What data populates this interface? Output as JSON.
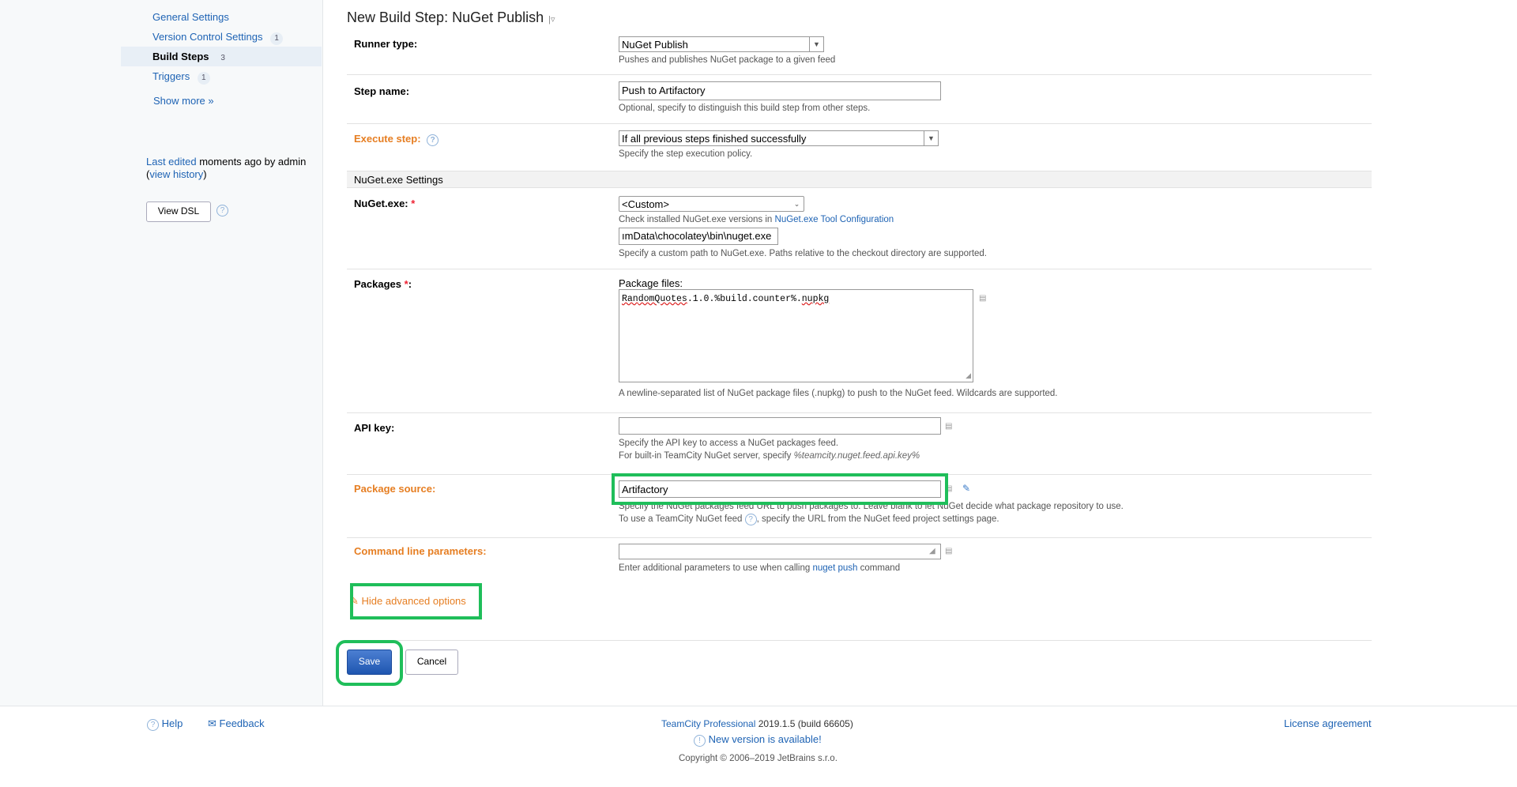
{
  "sidebar": {
    "items": [
      {
        "label": "General Settings",
        "badge": ""
      },
      {
        "label": "Version Control Settings",
        "badge": "1"
      },
      {
        "label": "Build Steps",
        "badge": "3"
      },
      {
        "label": "Triggers",
        "badge": "1"
      }
    ],
    "show_more": "Show more »",
    "last_edited_link": "Last edited",
    "last_edited_text": " moments ago by admin",
    "view_history_prefix": "(",
    "view_history": "view history",
    "view_history_suffix": ")",
    "view_dsl": "View DSL"
  },
  "page": {
    "title": "New Build Step: NuGet Publish",
    "title_caret": "|▿"
  },
  "runner": {
    "label": "Runner type:",
    "value": "NuGet Publish",
    "note": "Pushes and publishes NuGet package to a given feed"
  },
  "step_name": {
    "label": "Step name:",
    "value": "Push to Artifactory",
    "note": "Optional, specify to distinguish this build step from other steps."
  },
  "execute": {
    "label": "Execute step:",
    "value": "If all previous steps finished successfully",
    "note": "Specify the step execution policy."
  },
  "section": {
    "title": "NuGet.exe Settings"
  },
  "nuget_exe": {
    "label": "NuGet.exe:",
    "required": "*",
    "value": "<Custom>",
    "note_prefix": "Check installed NuGet.exe versions in ",
    "note_link": "NuGet.exe Tool Configuration",
    "path": "ımData\\chocolatey\\bin\\nuget.exe",
    "path_note": "Specify a custom path to NuGet.exe. Paths relative to the checkout directory are supported."
  },
  "packages": {
    "label": "Packages",
    "required": "*",
    "label_suffix": ":",
    "files_label": "Package files:",
    "value_a": "Ran",
    "value_b": "domQuotes",
    "value_c": ".1.0.%build.counter%.",
    "value_d": "nupkg",
    "note": "A newline-separated list of NuGet package files (.nupkg) to push to the NuGet feed. Wildcards are supported."
  },
  "api_key": {
    "label": "API key:",
    "value": "",
    "note1": "Specify the API key to access a NuGet packages feed.",
    "note2_prefix": "For built-in TeamCity NuGet server, specify ",
    "note2_param": "%teamcity.nuget.feed.api.key%"
  },
  "source": {
    "label": "Package source:",
    "value": "Artifactory",
    "note1": "Specify the NuGet packages feed URL to push packages to. Leave blank to let NuGet decide what package repository to use.",
    "note2_prefix": "To use a TeamCity NuGet feed ",
    "note2_suffix": ", specify the URL from the NuGet feed project settings page."
  },
  "cmdline": {
    "label": "Command line parameters:",
    "value": "",
    "note_prefix": "Enter additional parameters to use when calling ",
    "note_link": "nuget push",
    "note_suffix": " command"
  },
  "actions": {
    "hide_advanced": "Hide advanced options",
    "save": "Save",
    "cancel": "Cancel"
  },
  "footer": {
    "help": "Help",
    "feedback": "Feedback",
    "product_link": "TeamCity Professional",
    "version": " 2019.1.5 (build 66605)",
    "new_version": "New version is available!",
    "copyright": "Copyright © 2006–2019 JetBrains s.r.o.",
    "license": "License agreement"
  },
  "colors": {
    "link": "#1e63b4",
    "orange_label": "#e67e22",
    "highlight": "#1fbe5a",
    "save_button": "#2b62bd"
  }
}
